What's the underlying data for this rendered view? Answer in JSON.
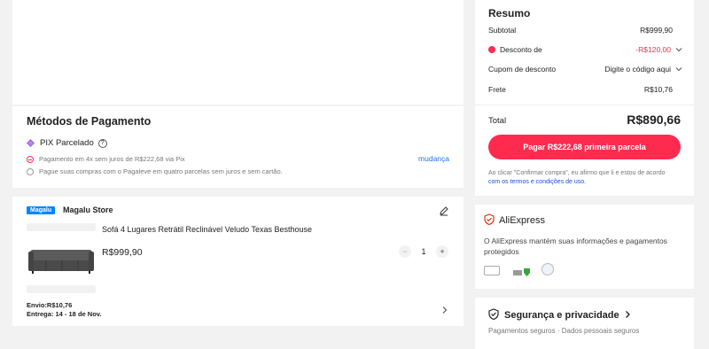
{
  "payment": {
    "title": "Métodos de Pagamento",
    "pix_label": "PIX Parcelado",
    "info_icon": "info-icon",
    "installment_note": "Pagamento em 4x sem juros de R$222,68 via Pix",
    "change_link": "mudança",
    "pagaleve_note": "Pague suas compras com o Pagaleve em quatro parcelas sem juros e sem cartão."
  },
  "store": {
    "badge": "Magalu",
    "name": "Magalu Store",
    "product_name": "Sofá 4 Lugares Retrátil Reclinável Veludo Texas Besthouse",
    "price": "R$999,90",
    "quantity": "1",
    "minus": "−",
    "plus": "+",
    "shipping": "Envio:R$10,76",
    "delivery": "Entrega: 14 - 18 de Nov."
  },
  "summary": {
    "title": "Resumo",
    "subtotal_label": "Subtotal",
    "subtotal_value": "R$999,90",
    "discount_label": "Desconto de",
    "discount_value": "-R$120,00",
    "coupon_label": "Cupom de desconto",
    "coupon_value": "Digite o código aqui",
    "shipping_label": "Frete",
    "shipping_value": "R$10,76",
    "total_label": "Total",
    "total_value": "R$890,66",
    "pay_button": "Pagar R$222,68 primeira parcela",
    "terms_prefix": "Ao clicar \"Confirmar compra\", eu afirmo que li e estou de acordo ",
    "terms_link": "com os termos e condições de uso.",
    "accent": "#ff2b4f"
  },
  "aliexpress": {
    "name": "AliExpress",
    "text": "O AliExpress mantém suas informações e pagamentos protegidos"
  },
  "security": {
    "title": "Segurança e privacidade",
    "subtitle": "Pagamentos seguros · Dados pessoais seguros"
  }
}
